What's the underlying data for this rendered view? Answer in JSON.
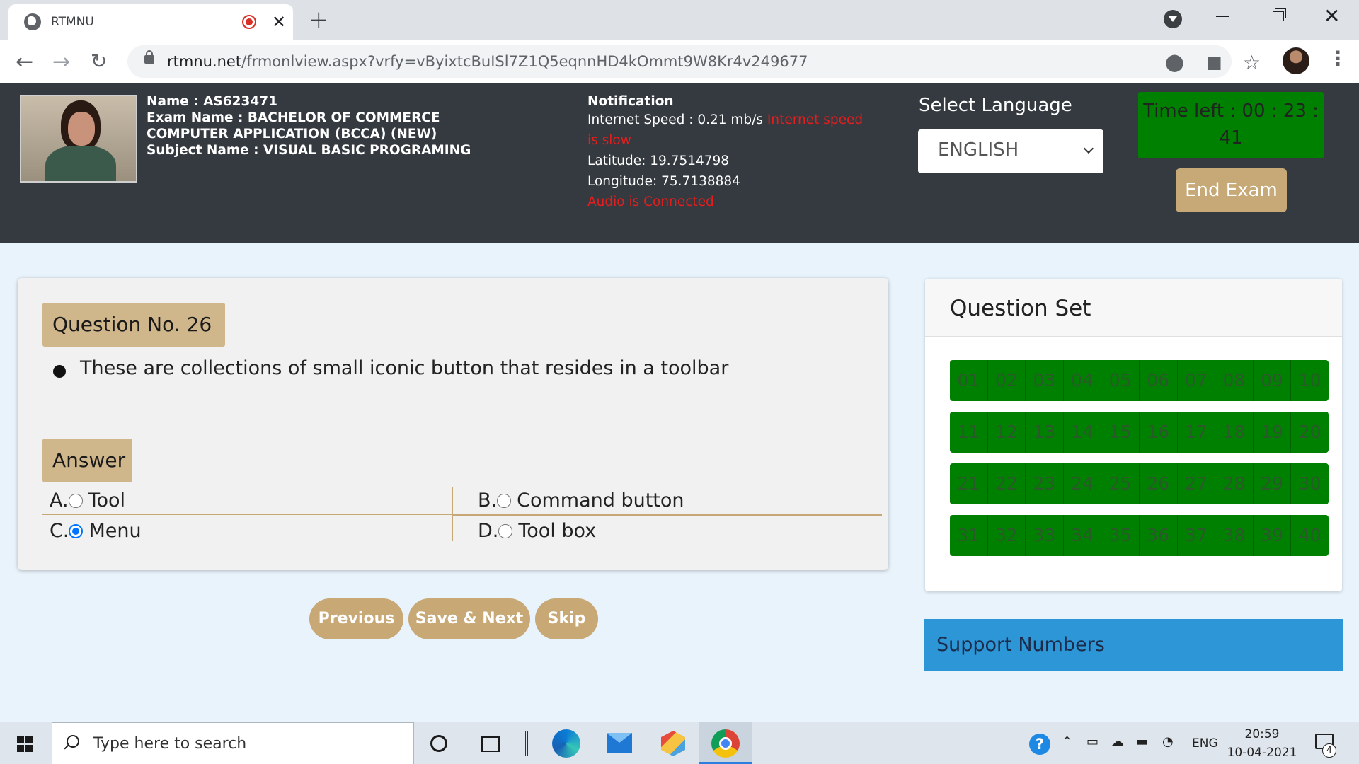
{
  "browser": {
    "tab_title": "RTMNU",
    "url_host": "rtmnu.net",
    "url_path": "/frmonlview.aspx?vrfy=vByixtcBuISl7Z1Q5eqnnHD4kOmmt9W8Kr4v249677"
  },
  "header": {
    "name_line": "Name : AS623471",
    "exam_line": "Exam Name : BACHELOR OF COMMERCE COMPUTER APPLICATION (BCCA) (NEW)",
    "subject_line": "Subject Name : VISUAL BASIC PROGRAMING",
    "notification_title": "Notification",
    "internet_speed": "Internet Speed : 0.21 mb/s ",
    "internet_warning": "Internet speed is slow",
    "latitude": "Latitude: 19.7514798",
    "longitude": "Longitude: 75.7138884",
    "audio_status": "Audio is Connected",
    "language_label": "Select Language",
    "language_value": "ENGLISH",
    "timer": "Time left : 00 : 23 : 41",
    "end_exam": "End Exam"
  },
  "question": {
    "number_label": "Question No.  26",
    "text": "These are collections of small iconic button that resides in a toolbar",
    "answer_label": "Answer",
    "options": [
      {
        "letter": "A.",
        "text": "Tool",
        "selected": false
      },
      {
        "letter": "B.",
        "text": "Command button",
        "selected": false
      },
      {
        "letter": "C.",
        "text": "Menu",
        "selected": true
      },
      {
        "letter": "D.",
        "text": "Tool box",
        "selected": false
      }
    ]
  },
  "nav": {
    "previous": "Previous",
    "save_next": "Save & Next",
    "skip": "Skip"
  },
  "question_set": {
    "title": "Question Set",
    "numbers": [
      "01",
      "02",
      "03",
      "04",
      "05",
      "06",
      "07",
      "08",
      "09",
      "10",
      "11",
      "12",
      "13",
      "14",
      "15",
      "16",
      "17",
      "18",
      "19",
      "20",
      "21",
      "22",
      "23",
      "24",
      "25",
      "26",
      "27",
      "28",
      "29",
      "30",
      "31",
      "32",
      "33",
      "34",
      "35",
      "36",
      "37",
      "38",
      "39",
      "40"
    ]
  },
  "support": {
    "title": "Support Numbers"
  },
  "taskbar": {
    "search_placeholder": "Type here to search",
    "lang": "ENG",
    "time": "20:59",
    "date": "10-04-2021",
    "notification_count": "4"
  },
  "colors": {
    "header_bg": "#343a40",
    "timer_green": "#008000",
    "accent_tan": "#c8a875",
    "warning_red": "#e61d1d",
    "support_blue": "#2d96d6",
    "selected_radio": "#0075ff"
  }
}
